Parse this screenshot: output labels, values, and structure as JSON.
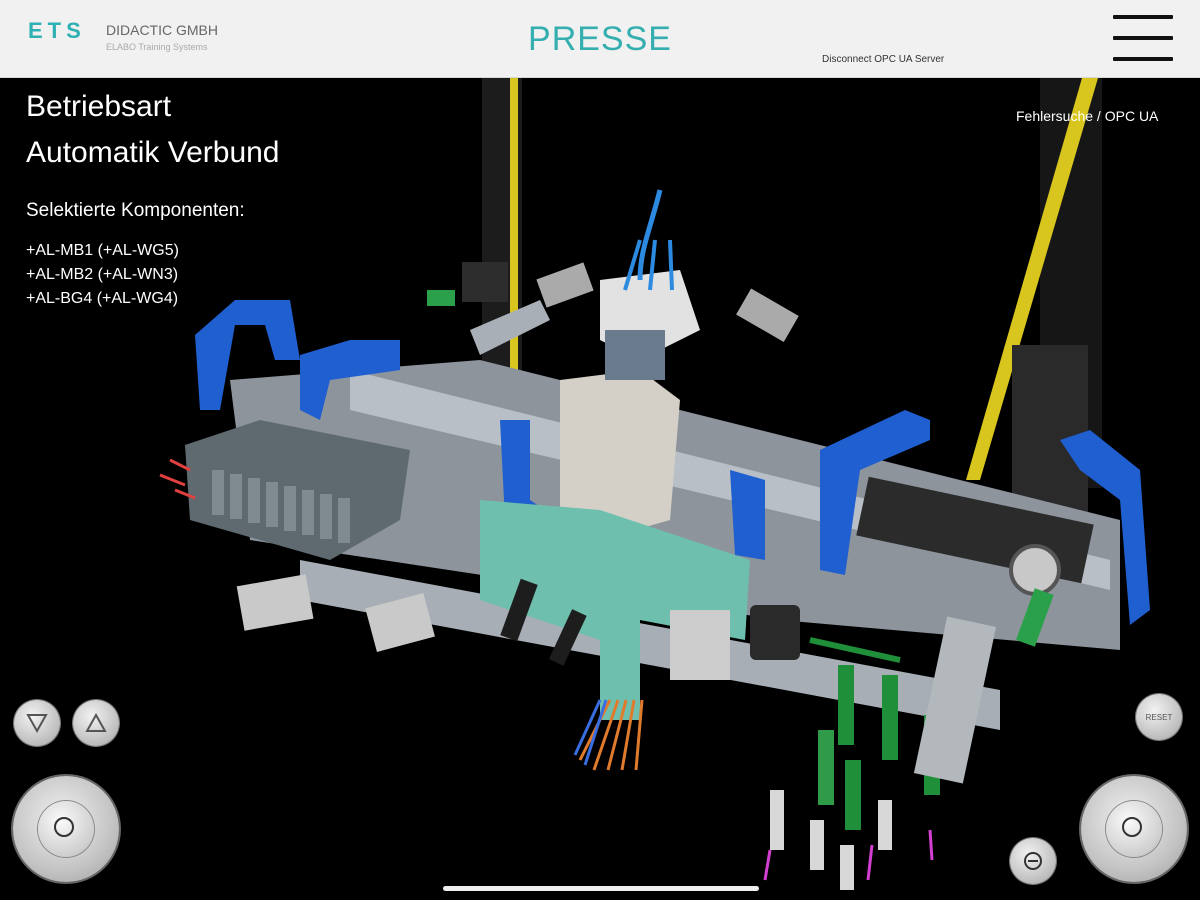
{
  "header": {
    "logo_mark": "ETS",
    "company": "DIDACTIC GMBH",
    "subtitle": "ELABO Training Systems",
    "title": "PRESSE",
    "disconnect_label": "Disconnect OPC UA Server"
  },
  "info": {
    "mode_label": "Betriebsart",
    "mode_value": "Automatik Verbund",
    "selected_heading": "Selektierte Komponenten:",
    "components": [
      "+AL-MB1 (+AL-WG5)",
      "+AL-MB2 (+AL-WN3)",
      "+AL-BG4 (+AL-WG4)"
    ],
    "fault_link": "Fehlersuche / OPC UA"
  },
  "controls": {
    "down_icon": "triangle-down-icon",
    "up_icon": "triangle-up-icon",
    "reset_label": "RESET",
    "rotate_icon": "rotate-icon"
  },
  "colors": {
    "brand": "#35aeb0",
    "rail_blue": "#1f5fcf",
    "module_green": "#6fbfae",
    "cable_green": "#1f8f3a",
    "yellow": "#d8c51e"
  }
}
